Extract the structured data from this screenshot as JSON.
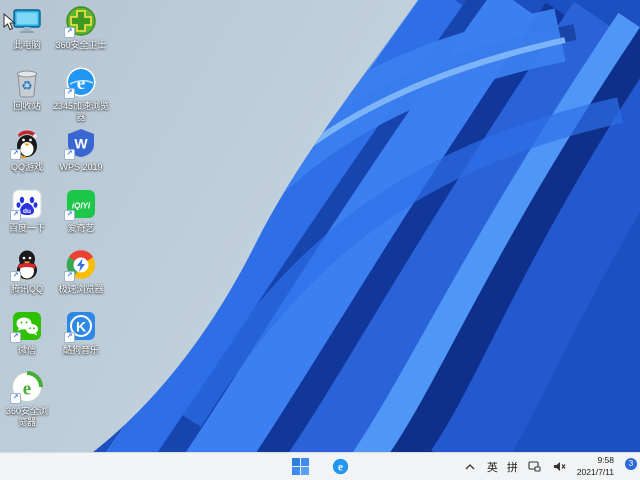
{
  "wallpaper": {
    "description": "Windows 11 blue bloom on light steel-blue background",
    "background_color": "#bac9d6",
    "bloom_primary": "#2e6fe8",
    "bloom_dark": "#0e2f8a",
    "bloom_light": "#6fa9f6"
  },
  "desktop": {
    "icons": [
      {
        "label": "此电脑",
        "icon": "this-pc-icon",
        "shortcut": false
      },
      {
        "label": "360安全卫士",
        "icon": "360-safe-icon",
        "shortcut": true
      },
      {
        "label": "回收站",
        "icon": "recycle-bin-icon",
        "shortcut": false
      },
      {
        "label": "2345加速浏览器",
        "icon": "2345-browser-icon",
        "shortcut": true
      },
      {
        "label": "QQ游戏",
        "icon": "qq-games-icon",
        "shortcut": true
      },
      {
        "label": "WPS 2019",
        "icon": "wps-2019-icon",
        "shortcut": true
      },
      {
        "label": "百度一下",
        "icon": "baidu-icon",
        "shortcut": true
      },
      {
        "label": "爱奇艺",
        "icon": "iqiyi-icon",
        "shortcut": true
      },
      {
        "label": "腾讯QQ",
        "icon": "tencent-qq-icon",
        "shortcut": true
      },
      {
        "label": "极速浏览器",
        "icon": "speed-browser-icon",
        "shortcut": true
      },
      {
        "label": "微信",
        "icon": "wechat-icon",
        "shortcut": true
      },
      {
        "label": "酷狗音乐",
        "icon": "kugou-music-icon",
        "shortcut": true
      },
      {
        "label": "360安全浏览器",
        "icon": "360-browser-icon",
        "shortcut": true
      }
    ],
    "shortcut_arrow": "↗"
  },
  "taskbar": {
    "tray": {
      "ime_lang": "英",
      "ime_mode": "拼",
      "time": "9:58",
      "date": "2021/7/11",
      "badge_count": "3"
    }
  }
}
